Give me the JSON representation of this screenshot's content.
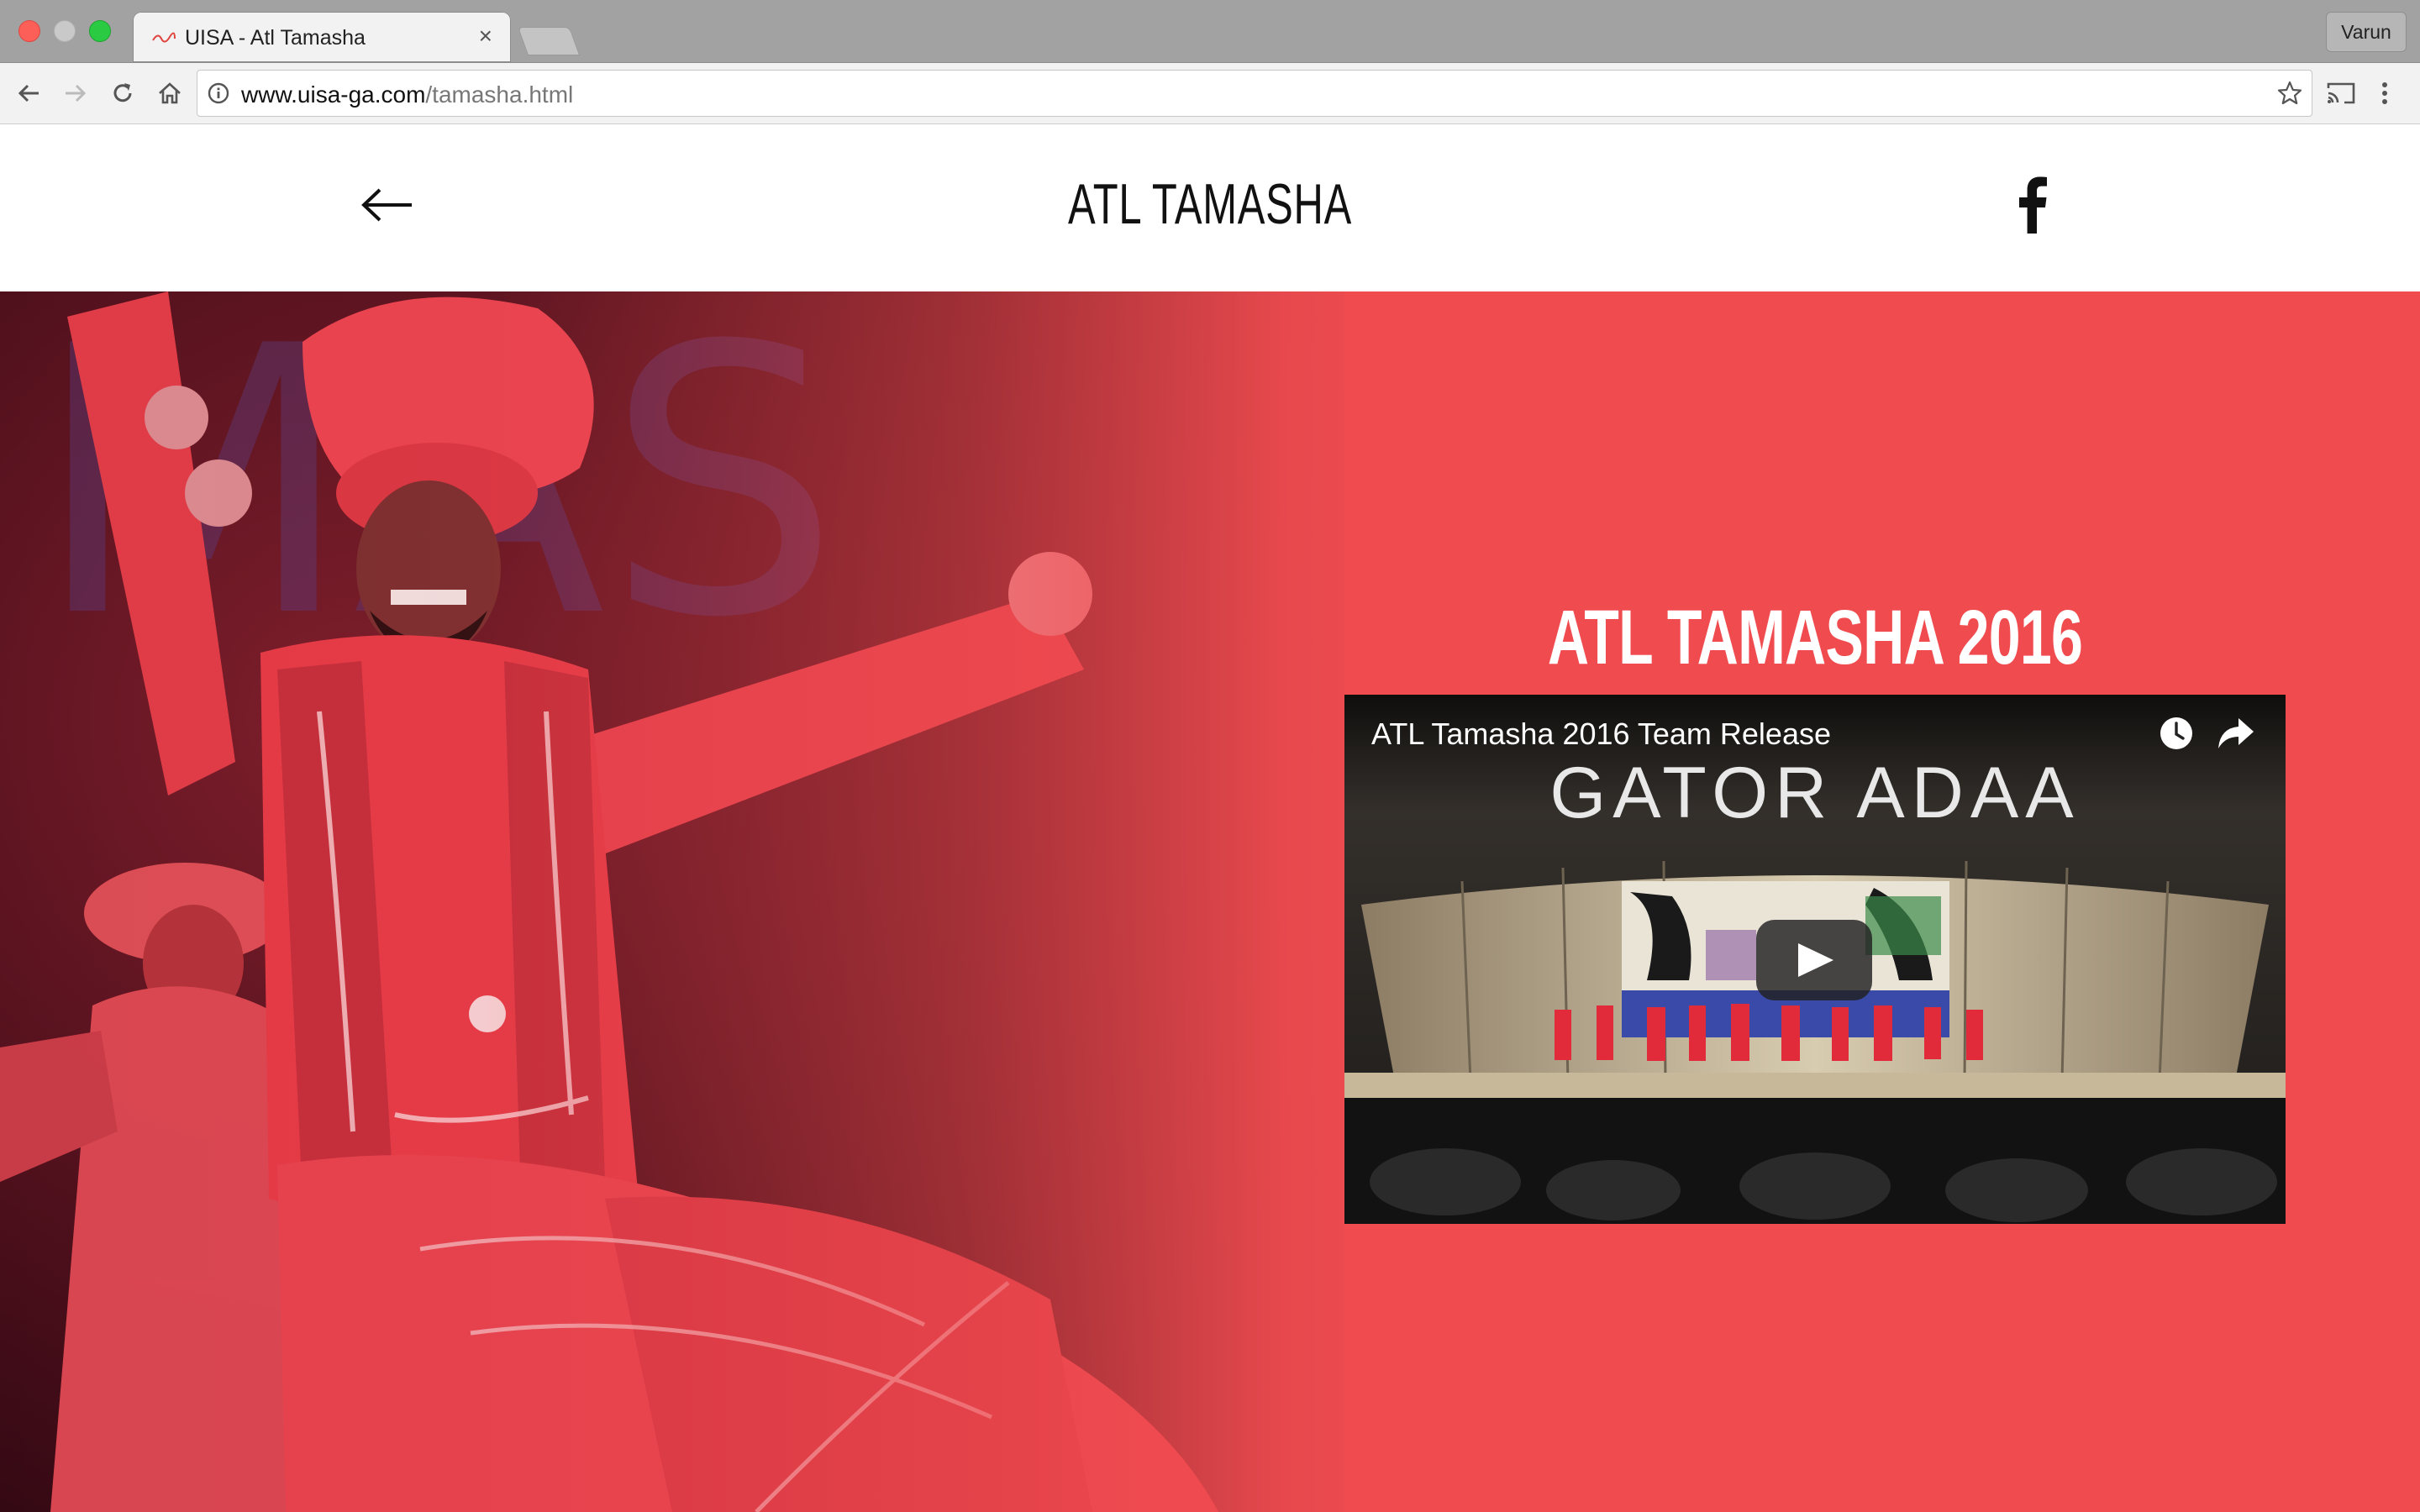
{
  "browser": {
    "tab_title": "UISA - Atl Tamasha",
    "tab_close": "×",
    "profile_name": "Varun",
    "url_host": "www.uisa-ga.com",
    "url_path": "/tamasha.html",
    "icons": [
      "back-icon",
      "forward-icon",
      "reload-icon",
      "home-icon",
      "info-icon",
      "bookmark-star-icon",
      "cast-icon",
      "menu-icon"
    ]
  },
  "header": {
    "title": "ATL TAMASHA",
    "back_icon": "arrow-left-icon",
    "social_icon": "facebook-icon"
  },
  "hero": {
    "section_title": "ATL TAMASHA 2016",
    "background_color": "#f04c50",
    "video": {
      "title": "ATL Tamasha 2016 Team Release",
      "banner": "GATOR ADAA",
      "icons": [
        "watch-later-icon",
        "share-icon",
        "play-icon"
      ]
    }
  }
}
